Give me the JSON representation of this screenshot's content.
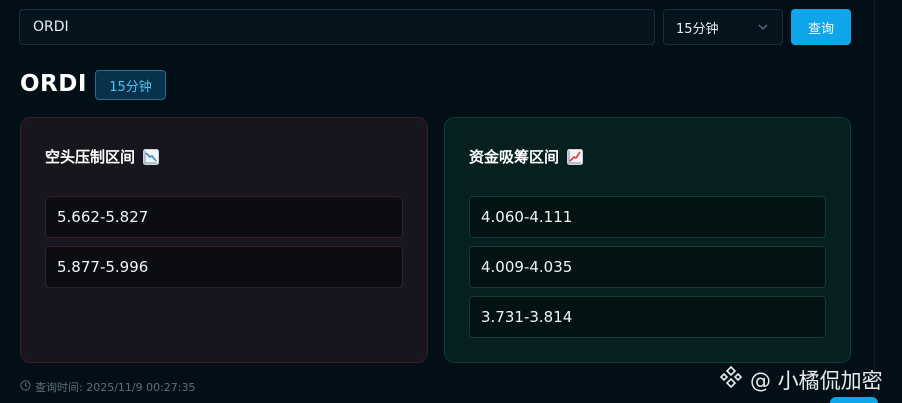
{
  "search": {
    "value": "ORDI"
  },
  "interval_select": {
    "selected": "15分钟"
  },
  "query_button": {
    "label": "查询"
  },
  "header": {
    "symbol": "ORDI",
    "interval_badge": "15分钟"
  },
  "short_zone": {
    "title": "空头压制区间",
    "icon": "chart-decreasing-icon",
    "ranges": [
      "5.662-5.827",
      "5.877-5.996"
    ]
  },
  "accumulation_zone": {
    "title": "资金吸筹区间",
    "icon": "chart-increasing-icon",
    "ranges": [
      "4.060-4.111",
      "4.009-4.035",
      "3.731-3.814"
    ]
  },
  "footer": {
    "query_time": "查询时间: 2025/11/9 00:27:35"
  },
  "watermark": {
    "text": "@ 小橘侃加密"
  },
  "colors": {
    "accent": "#0ea5e9",
    "short_border": "#3a1d26",
    "accum_border": "#123a34"
  }
}
